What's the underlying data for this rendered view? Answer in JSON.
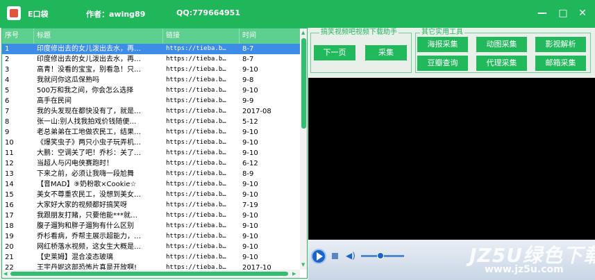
{
  "titlebar": {
    "app_name": "E口袋",
    "author": "作者：awing89",
    "qq": "QQ:779664951",
    "min_glyph": "—",
    "max_glyph": "□",
    "close_glyph": "✕"
  },
  "colors": {
    "accent": "#1fb75a",
    "selection": "#3c8ce8",
    "header": "#5dcf8e"
  },
  "table": {
    "headers": [
      "序号",
      "标题",
      "链接",
      "时间"
    ],
    "rows": [
      {
        "no": "1",
        "title": "印度修出去的女儿泼出去水，再…",
        "link": "https://tieba.b…",
        "time": "8-7",
        "selected": true
      },
      {
        "no": "2",
        "title": "印度修出去的女儿泼出去水，再…",
        "link": "https://tieba.b…",
        "time": "8-7"
      },
      {
        "no": "3",
        "title": "高青！没看的宝宝，别看急！只…",
        "link": "https://tieba.b…",
        "time": "9-10"
      },
      {
        "no": "4",
        "title": "我就问你这瓜保熟吗",
        "link": "https://tieba.b…",
        "time": "9-8"
      },
      {
        "no": "5",
        "title": "500万和我之间，你会怎么选择",
        "link": "https://tieba.b…",
        "time": "9-10"
      },
      {
        "no": "6",
        "title": "高手在民间",
        "link": "https://tieba.b…",
        "time": "9-9"
      },
      {
        "no": "7",
        "title": "我的头发现在都快没有了，就是…",
        "link": "https://tieba.b…",
        "time": "2017-08"
      },
      {
        "no": "8",
        "title": "张一山:别人找我拍戏价钱随便…",
        "link": "https://tieba.b…",
        "time": "5-12"
      },
      {
        "no": "9",
        "title": "老总弟弟在工地做农民工，结果…",
        "link": "https://tieba.b…",
        "time": "9-10"
      },
      {
        "no": "10",
        "title": "《爆笑虫子》两只小虫子玩弄机…",
        "link": "https://tieba.b…",
        "time": "9-10"
      },
      {
        "no": "11",
        "title": "大鹏：空调关了吧！乔杉：关了…",
        "link": "https://tieba.b…",
        "time": "9-10"
      },
      {
        "no": "12",
        "title": "当超人与闪电侠赛跑时！",
        "link": "https://tieba.b…",
        "time": "6-12"
      },
      {
        "no": "13",
        "title": "下来之前，必须让我嗨一段尬舞",
        "link": "https://tieba.b…",
        "time": "8-9"
      },
      {
        "no": "14",
        "title": "【音MAD】⑨奶粉歌×Cookie☆",
        "link": "https://tieba.b…",
        "time": "9-10"
      },
      {
        "no": "15",
        "title": "美女不尊重农民工，没想到美女…",
        "link": "https://tieba.b…",
        "time": "9-10"
      },
      {
        "no": "16",
        "title": "大家好大家的视频都好搞笑呀",
        "link": "https://tieba.b…",
        "time": "7-19"
      },
      {
        "no": "17",
        "title": "我跟朋友打赌，只要他能***就…",
        "link": "https://tieba.b…",
        "time": "9-10"
      },
      {
        "no": "18",
        "title": "腹子遛狗和胖子遛狗有什么区别",
        "link": "https://tieba.b…",
        "time": "9-10"
      },
      {
        "no": "19",
        "title": "乔杉看病，乔帮主展示超能力，…",
        "link": "https://tieba.b…",
        "time": "9-10"
      },
      {
        "no": "20",
        "title": "网红桥落水视频，这女生大概是…",
        "link": "https://tieba.b…",
        "time": "9-10"
      },
      {
        "no": "21",
        "title": "【史莱姆】混合凌态玻璃",
        "link": "https://tieba.b…",
        "time": "9-10"
      },
      {
        "no": "22",
        "title": "王宇丹妮这部恐怖片真是开放啊!",
        "link": "https://tieba.b…",
        "time": "2017-10"
      }
    ]
  },
  "scroll": {
    "up": "▲",
    "down": "▼",
    "left": "◀",
    "right": "▶"
  },
  "download_helper": {
    "label": "搞笑视频吧视频下载助手",
    "next_page": "下一页",
    "collect": "采集"
  },
  "tools": {
    "label": "其它实用工具",
    "buttons": [
      "海报采集",
      "动图采集",
      "影视解析",
      "豆瓣查询",
      "代理采集",
      "邮箱采集"
    ]
  },
  "player": {
    "volume_glyph": "◀)",
    "volume_level": 0.45
  },
  "watermark": {
    "logo": "JZ5U绿色下载",
    "url": "www.jz5u.com"
  }
}
